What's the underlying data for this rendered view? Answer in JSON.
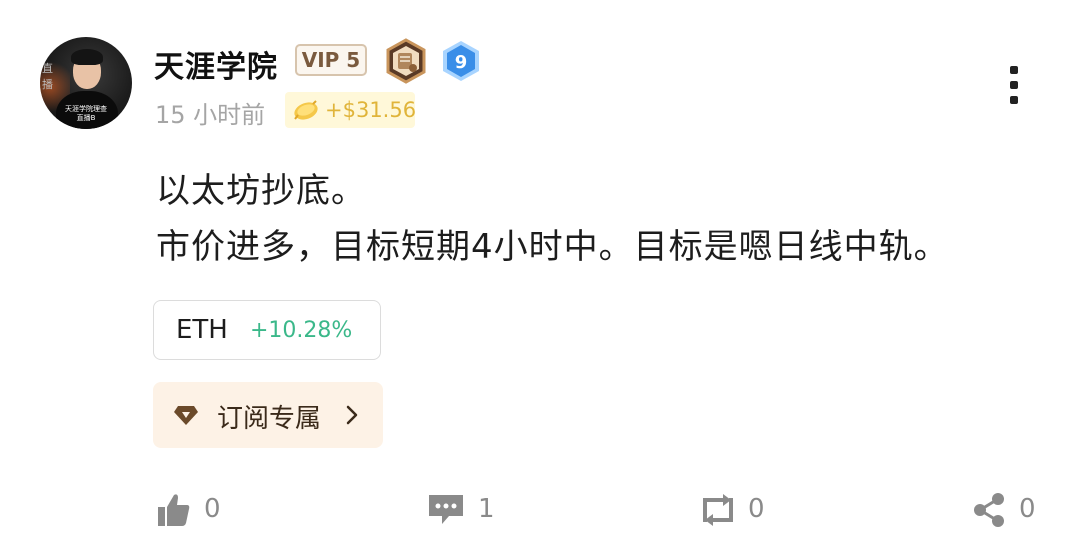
{
  "author": {
    "name": "天涯学院",
    "vip": "VIP 5",
    "level": "9",
    "avatar_caption": "天涯学院理查\n直播B",
    "avatar_side_text": "直\n播"
  },
  "post": {
    "time": "15 小时前",
    "tip_amount": "+$31.56",
    "lines": [
      "以太坊抄底。",
      "市价进多，目标短期4小时中。目标是嗯日线中轨。"
    ]
  },
  "coin_tag": {
    "symbol": "ETH",
    "change": "+10.28%"
  },
  "subscribe": {
    "label": "订阅专属"
  },
  "actions": {
    "likes": "0",
    "comments": "1",
    "reposts": "0",
    "shares": "0"
  },
  "colors": {
    "positive": "#3bb88a",
    "tip_text": "#e0b43a",
    "subscribe_bg": "#fdf2e6",
    "vip_border": "#d7c4ad",
    "level_blue": "#3a8ee8"
  },
  "icons": {
    "more": "more-vertical-icon",
    "like": "thumbs-up-icon",
    "comment": "comment-icon",
    "repost": "repost-icon",
    "share": "share-icon",
    "subscribe": "diamond-icon",
    "tip": "coin-tip-icon",
    "medal": "medal-badge-icon",
    "level": "level-badge-icon"
  }
}
